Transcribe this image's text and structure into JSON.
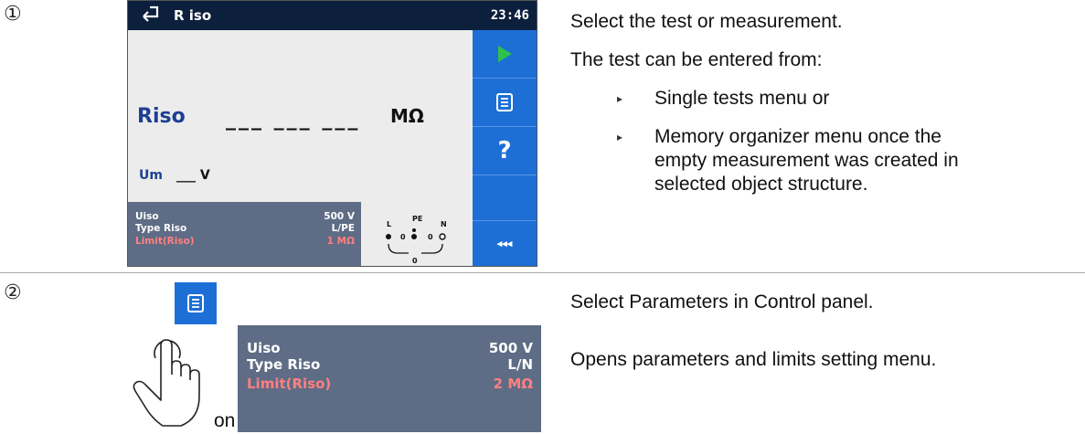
{
  "steps": {
    "first": "①",
    "second": "②"
  },
  "screen": {
    "title": "R iso",
    "time": "23:46",
    "riso_label": "Riso",
    "riso_value": "___ ___ ___",
    "riso_unit": "MΩ",
    "um_label": "Um",
    "um_value": "___ V",
    "params": [
      {
        "name": "Uiso",
        "value": "500 V"
      },
      {
        "name": "Type Riso",
        "value": "L/PE"
      },
      {
        "name": "Limit(Riso)",
        "value": "1 MΩ"
      }
    ],
    "terminals": {
      "l": "L",
      "pe": "PE",
      "n": "N",
      "zero": "0"
    },
    "sidebar_more": "◂◂◂"
  },
  "step1": {
    "heading": "Select the test or measurement.",
    "entry_intro": "The test can be entered from:",
    "bullet1": "Single tests menu or",
    "bullet2_line1": "Memory organizer menu once the",
    "bullet2_line2": "empty measurement was created in",
    "bullet2_line3": "selected object structure."
  },
  "step2": {
    "heading": "Select Parameters in Control panel.",
    "on_label": "on",
    "description": "Opens parameters and limits setting menu.",
    "params": [
      {
        "name": "Uiso",
        "value": "500 V"
      },
      {
        "name": "Type Riso",
        "value": "L/N"
      },
      {
        "name": "Limit(Riso)",
        "value": "2 MΩ"
      }
    ]
  },
  "colors": {
    "title_bar": "#0c1f3d",
    "sidebar_blue": "#1d6fd6",
    "play_green": "#2fc14e",
    "param_panel": "#5e6c85",
    "limit_red": "#ff8080",
    "riso_label_blue": "#1d3f94"
  }
}
